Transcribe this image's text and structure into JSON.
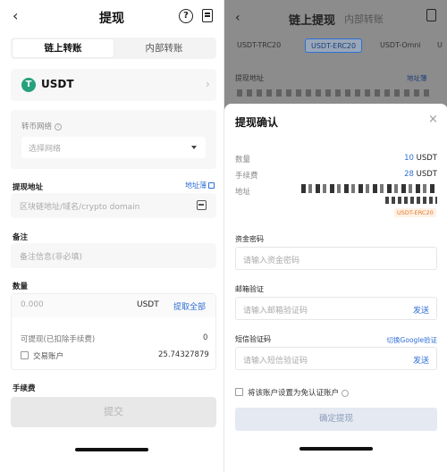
{
  "left": {
    "header": {
      "back": "‹",
      "title": "提现",
      "help": "?"
    },
    "tabs": [
      {
        "label": "链上转账"
      },
      {
        "label": "内部转账"
      }
    ],
    "coin": {
      "icon_letter": "T",
      "name": "USDT",
      "chevron": "›",
      "icon_color": "#26a17b"
    },
    "network": {
      "label": "转币网络",
      "placeholder": "选择网络"
    },
    "address": {
      "label": "提现地址",
      "book": "地址薄",
      "placeholder": "区块链地址/域名/crypto domain"
    },
    "memo": {
      "label": "备注",
      "placeholder": "备注信息(非必填)"
    },
    "amount": {
      "label": "数量",
      "placeholder": "0.000",
      "unit": "USDT",
      "withdraw_all": "提取全部",
      "available_label": "可提现(已扣除手续费)",
      "available_value": "0",
      "account_label": "交易账户",
      "account_value": "25.74327879"
    },
    "fee": {
      "label": "手续费"
    },
    "submit": {
      "label": "提交"
    }
  },
  "right": {
    "header": {
      "back": "‹",
      "title": "链上提现",
      "subtitle": "内部转账"
    },
    "networks": [
      {
        "label": "USDT-TRC20"
      },
      {
        "label": "USDT-ERC20"
      },
      {
        "label": "USDT-Omni"
      },
      {
        "label": "U"
      }
    ],
    "address": {
      "label": "提现地址",
      "book": "地址薄"
    },
    "sheet": {
      "title": "提现确认",
      "close": "×",
      "quantity": {
        "label": "数量",
        "number": "10",
        "unit": "USDT"
      },
      "fee": {
        "label": "手续费",
        "number": "28",
        "unit": "USDT"
      },
      "address_label": "地址",
      "network_badge": "USDT-ERC20",
      "fund_password": {
        "label": "资金密码",
        "placeholder": "请输入资金密码"
      },
      "email_code": {
        "label": "邮箱验证",
        "placeholder": "请输入邮箱验证码",
        "action": "发送"
      },
      "sms_code": {
        "label": "短信验证码",
        "switch": "切换Google验证",
        "placeholder": "请输入短信验证码",
        "action": "发送"
      },
      "trust_label": "将该账户设置为免认证账户",
      "confirm": "确定提现"
    }
  },
  "colors": {
    "accent": "#2f6fd6",
    "badge": "#e07a2b",
    "tether": "#26a17b"
  }
}
